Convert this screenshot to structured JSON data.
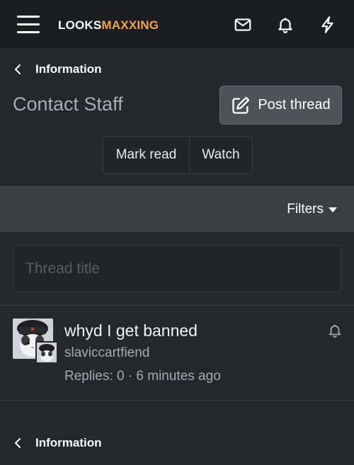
{
  "header": {
    "logo_part1": "LOOKS",
    "logo_part2": "MAXXING",
    "logo_color": "#f2a44f",
    "icons": [
      "menu-icon",
      "mail-icon",
      "bell-icon",
      "bolt-icon"
    ]
  },
  "breadcrumb_top": {
    "label": "Information"
  },
  "page": {
    "title": "Contact Staff",
    "post_button": "Post thread",
    "mark_read": "Mark read",
    "watch": "Watch"
  },
  "filters": {
    "label": "Filters"
  },
  "search": {
    "placeholder": "Thread title",
    "value": ""
  },
  "threads": [
    {
      "title": "whyd I get banned",
      "author": "slaviccartfiend",
      "replies_label": "Replies:",
      "replies": "0",
      "separator": "·",
      "time": "6 minutes ago"
    }
  ],
  "breadcrumb_bottom": {
    "label": "Information"
  }
}
